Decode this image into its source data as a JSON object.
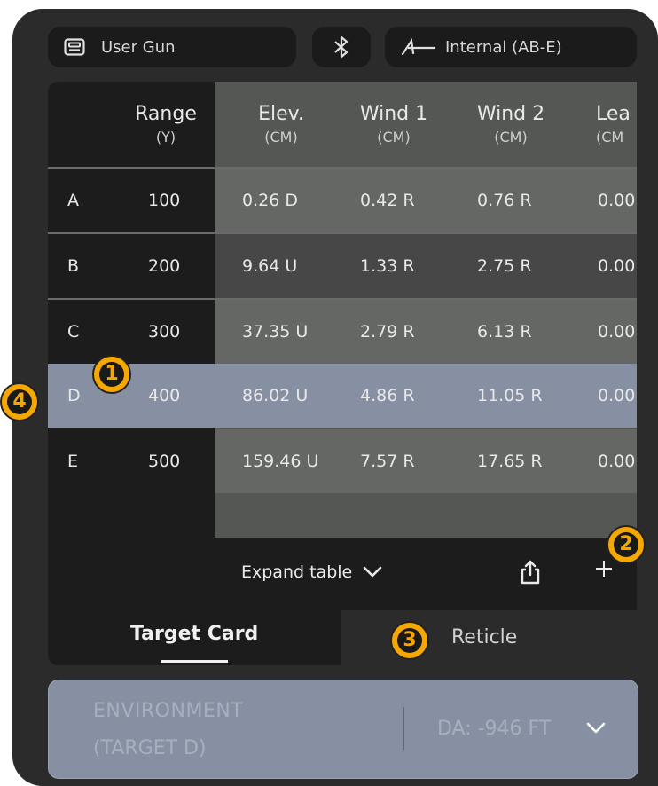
{
  "top_bar": {
    "gun_label": "User Gun",
    "source_label": "Internal (AB-E)"
  },
  "table": {
    "columns": [
      {
        "title": "Range",
        "unit": "(Y)"
      },
      {
        "title": "Elev.",
        "unit": "(CM)"
      },
      {
        "title": "Wind 1",
        "unit": "(CM)"
      },
      {
        "title": "Wind 2",
        "unit": "(CM)"
      },
      {
        "title": "Lea",
        "unit": "(CM"
      }
    ],
    "rows": [
      {
        "id": "A",
        "range": "100",
        "elev": "0.26 D",
        "wind1": "0.42 R",
        "wind2": "0.76 R",
        "lead": "0.00"
      },
      {
        "id": "B",
        "range": "200",
        "elev": "9.64 U",
        "wind1": "1.33 R",
        "wind2": "2.75 R",
        "lead": "0.00"
      },
      {
        "id": "C",
        "range": "300",
        "elev": "37.35 U",
        "wind1": "2.79 R",
        "wind2": "6.13 R",
        "lead": "0.00"
      },
      {
        "id": "D",
        "range": "400",
        "elev": "86.02 U",
        "wind1": "4.86 R",
        "wind2": "11.05 R",
        "lead": "0.00"
      },
      {
        "id": "E",
        "range": "500",
        "elev": "159.46 U",
        "wind1": "7.57 R",
        "wind2": "17.65 R",
        "lead": "0.00"
      }
    ],
    "selected_row": "D",
    "expand_label": "Expand table"
  },
  "tabs": {
    "target_card": "Target Card",
    "reticle": "Reticle",
    "active": "Target Card"
  },
  "environment": {
    "line1": "ENVIRONMENT",
    "line2": "(TARGET D)",
    "da_value": "DA: -946 FT"
  },
  "markers": [
    "1",
    "2",
    "3",
    "4"
  ],
  "colors": {
    "device_bg": "#2b2b2b",
    "panel_bg": "#1c1c1c",
    "shade": "#555755",
    "selected": "#8790a3",
    "marker": "#f6a800"
  }
}
